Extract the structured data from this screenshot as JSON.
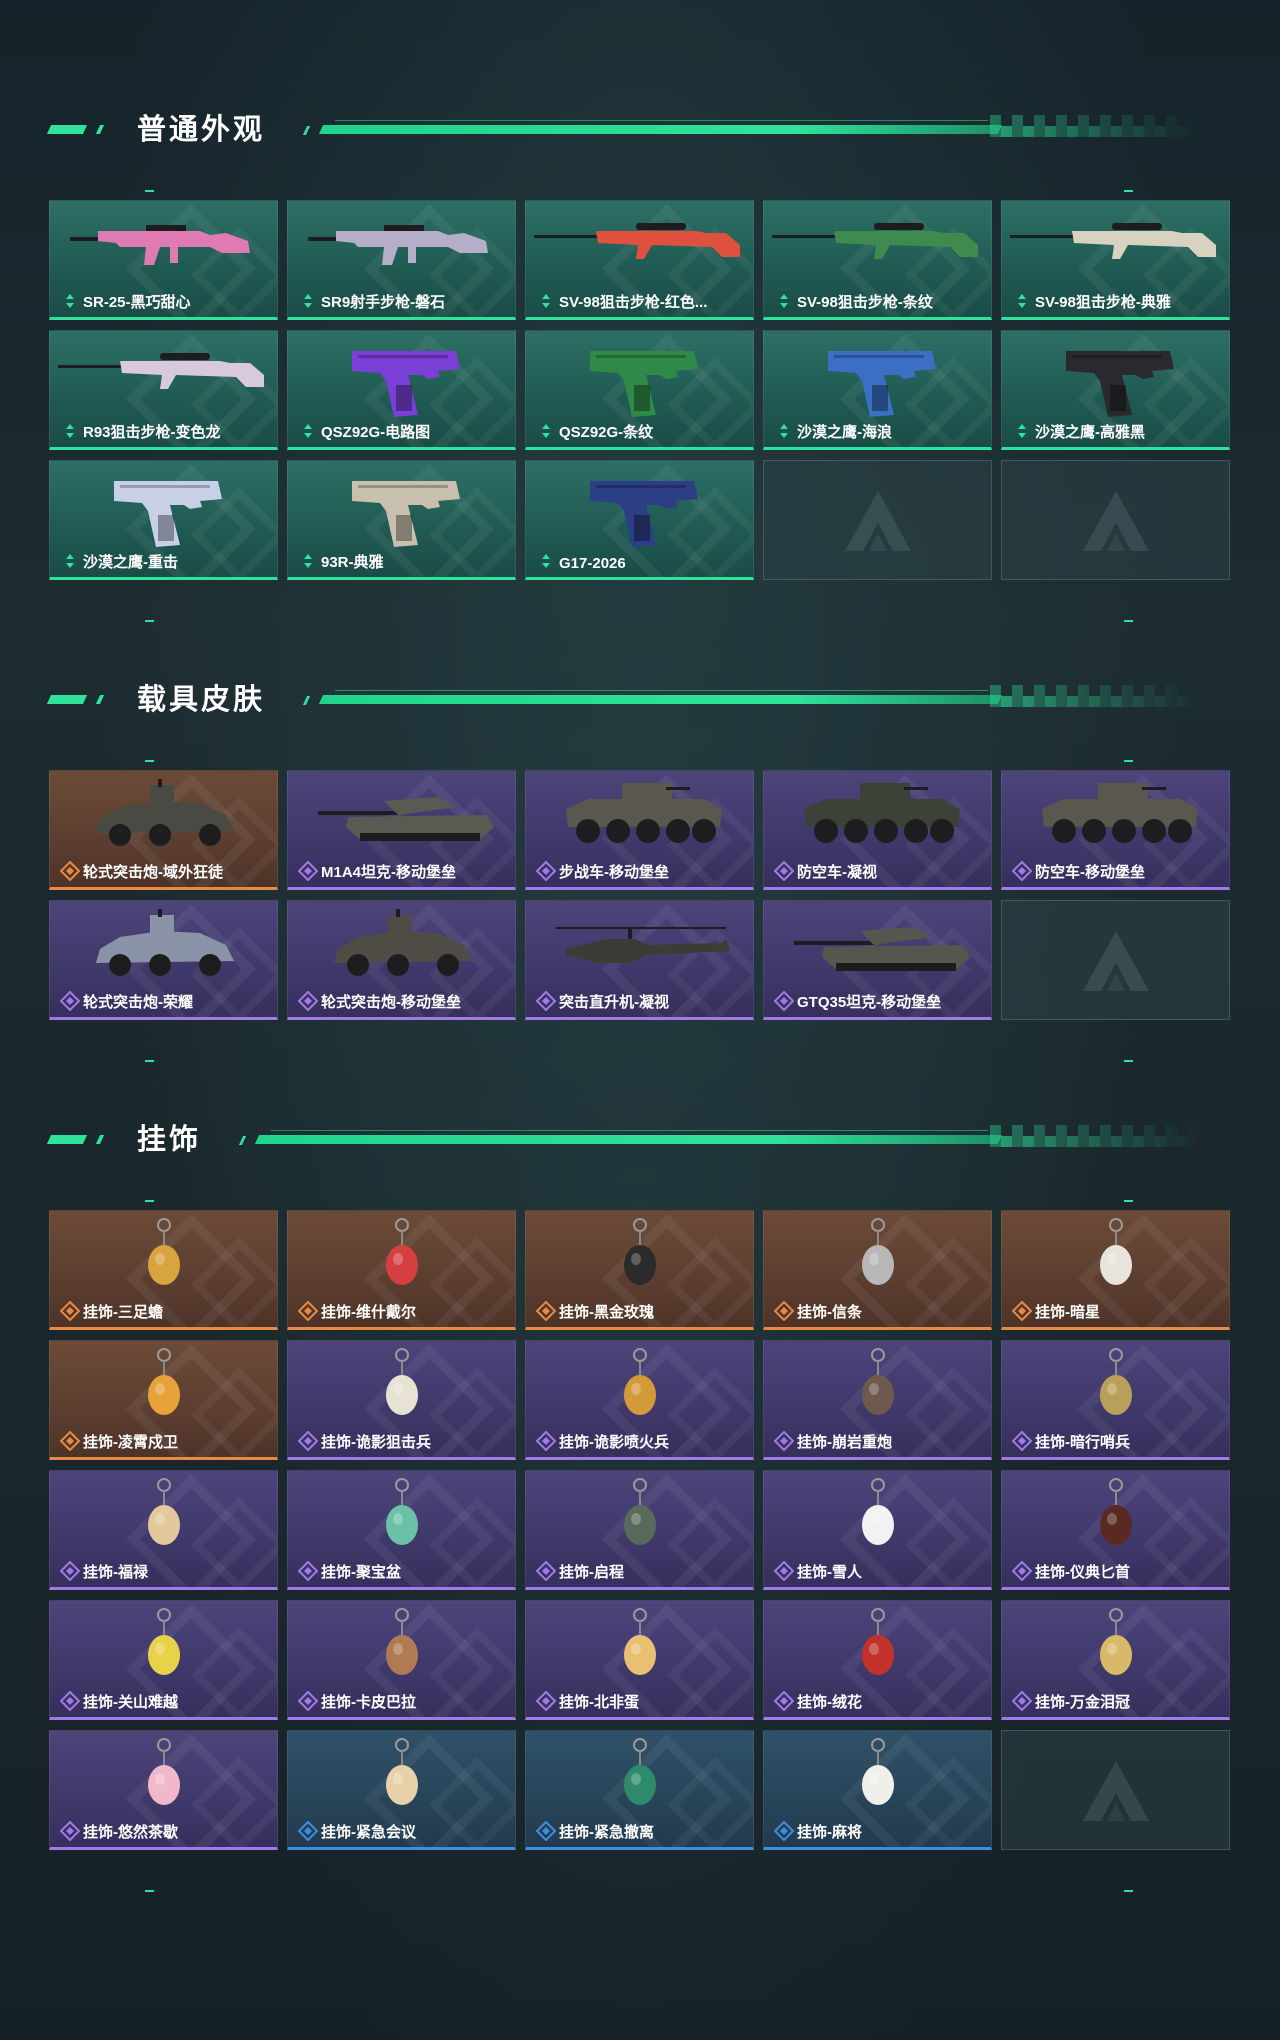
{
  "colors": {
    "accent": "#2fe39b",
    "tier_green": "#2fe39b",
    "tier_orange": "#e98a43",
    "tier_purple": "#a07ae6",
    "tier_blue": "#3f8de0",
    "background": "#1a262c"
  },
  "sections": [
    {
      "title": "普通外观",
      "items": [
        {
          "label": "SR-25-黑巧甜心",
          "tier": "green",
          "art": "rifle",
          "color": "#e07ab3"
        },
        {
          "label": "SR9射手步枪-磐石",
          "tier": "green",
          "art": "rifle",
          "color": "#b6aec9"
        },
        {
          "label": "SV-98狙击步枪-红色...",
          "tier": "green",
          "art": "sniper",
          "color": "#e0503f"
        },
        {
          "label": "SV-98狙击步枪-条纹",
          "tier": "green",
          "art": "sniper",
          "color": "#3f8a4e"
        },
        {
          "label": "SV-98狙击步枪-典雅",
          "tier": "green",
          "art": "sniper",
          "color": "#d8d2c0"
        },
        {
          "label": "R93狙击步枪-变色龙",
          "tier": "green",
          "art": "sniper",
          "color": "#d9c9dd"
        },
        {
          "label": "QSZ92G-电路图",
          "tier": "green",
          "art": "pistol",
          "color": "#7a3fd6"
        },
        {
          "label": "QSZ92G-条纹",
          "tier": "green",
          "art": "pistol",
          "color": "#2f8a48"
        },
        {
          "label": "沙漠之鹰-海浪",
          "tier": "green",
          "art": "pistol",
          "color": "#3a6fc4"
        },
        {
          "label": "沙漠之鹰-高雅黑",
          "tier": "green",
          "art": "pistol",
          "color": "#2a2a2e"
        },
        {
          "label": "沙漠之鹰-重击",
          "tier": "green",
          "art": "pistol",
          "color": "#c8d0e8"
        },
        {
          "label": "93R-典雅",
          "tier": "green",
          "art": "pistol",
          "color": "#c9bfae"
        },
        {
          "label": "G17-2026",
          "tier": "green",
          "art": "pistol",
          "color": "#2c3f86"
        },
        {
          "label": "",
          "tier": "empty",
          "art": "none",
          "color": ""
        },
        {
          "label": "",
          "tier": "empty",
          "art": "none",
          "color": ""
        }
      ]
    },
    {
      "title": "载具皮肤",
      "items": [
        {
          "label": "轮式突击炮-域外狂徒",
          "tier": "orange",
          "art": "vehicle",
          "color": "#4a4a44"
        },
        {
          "label": "M1A4坦克-移动堡垒",
          "tier": "purple",
          "art": "tank",
          "color": "#5b5a52"
        },
        {
          "label": "步战车-移动堡垒",
          "tier": "purple",
          "art": "apc",
          "color": "#5a574f"
        },
        {
          "label": "防空车-凝视",
          "tier": "purple",
          "art": "apc",
          "color": "#3d4238"
        },
        {
          "label": "防空车-移动堡垒",
          "tier": "purple",
          "art": "apc",
          "color": "#5a574f"
        },
        {
          "label": "轮式突击炮-荣耀",
          "tier": "purple",
          "art": "vehicle",
          "color": "#8a93a8"
        },
        {
          "label": "轮式突击炮-移动堡垒",
          "tier": "purple",
          "art": "vehicle",
          "color": "#4f4c45"
        },
        {
          "label": "突击直升机-凝视",
          "tier": "purple",
          "art": "heli",
          "color": "#3a3d35"
        },
        {
          "label": "GTQ35坦克-移动堡垒",
          "tier": "purple",
          "art": "tank",
          "color": "#57564e"
        },
        {
          "label": "",
          "tier": "empty",
          "art": "none",
          "color": ""
        }
      ]
    },
    {
      "title": "挂饰",
      "items": [
        {
          "label": "挂饰-三足蟾",
          "tier": "orange",
          "art": "charm",
          "color": "#d8a440"
        },
        {
          "label": "挂饰-维什戴尔",
          "tier": "orange",
          "art": "charm",
          "color": "#d63f3f"
        },
        {
          "label": "挂饰-黑金玫瑰",
          "tier": "orange",
          "art": "charm",
          "color": "#2b2b2b"
        },
        {
          "label": "挂饰-信条",
          "tier": "orange",
          "art": "charm",
          "color": "#b8b8b8"
        },
        {
          "label": "挂饰-暗星",
          "tier": "orange",
          "art": "charm",
          "color": "#e8e4dc"
        },
        {
          "label": "挂饰-凌霄戍卫",
          "tier": "orange",
          "art": "charm",
          "color": "#e8a23a"
        },
        {
          "label": "挂饰-诡影狙击兵",
          "tier": "purple",
          "art": "charm",
          "color": "#e8e2d4"
        },
        {
          "label": "挂饰-诡影喷火兵",
          "tier": "purple",
          "art": "charm",
          "color": "#d49a3a"
        },
        {
          "label": "挂饰-崩岩重炮",
          "tier": "purple",
          "art": "charm",
          "color": "#6d5a4c"
        },
        {
          "label": "挂饰-暗行哨兵",
          "tier": "purple",
          "art": "charm",
          "color": "#b8a05a"
        },
        {
          "label": "挂饰-福禄",
          "tier": "purple",
          "art": "charm",
          "color": "#e2c89a"
        },
        {
          "label": "挂饰-聚宝盆",
          "tier": "purple",
          "art": "charm",
          "color": "#6bc0a8"
        },
        {
          "label": "挂饰-启程",
          "tier": "purple",
          "art": "charm",
          "color": "#5a6a5a"
        },
        {
          "label": "挂饰-雪人",
          "tier": "purple",
          "art": "charm",
          "color": "#f2f2f2"
        },
        {
          "label": "挂饰-仪典匕首",
          "tier": "purple",
          "art": "charm",
          "color": "#5a2a22"
        },
        {
          "label": "挂饰-关山难越",
          "tier": "purple",
          "art": "charm",
          "color": "#e8d24a"
        },
        {
          "label": "挂饰-卡皮巴拉",
          "tier": "purple",
          "art": "charm",
          "color": "#b07a52"
        },
        {
          "label": "挂饰-北非蛋",
          "tier": "purple",
          "art": "charm",
          "color": "#e8c070"
        },
        {
          "label": "挂饰-绒花",
          "tier": "purple",
          "art": "charm",
          "color": "#c2322a"
        },
        {
          "label": "挂饰-万金泪冠",
          "tier": "purple",
          "art": "charm",
          "color": "#d9b86a"
        },
        {
          "label": "挂饰-悠然茶歇",
          "tier": "purple",
          "art": "charm",
          "color": "#f0b8c8"
        },
        {
          "label": "挂饰-紧急会议",
          "tier": "blue",
          "art": "charm",
          "color": "#e8d0a8"
        },
        {
          "label": "挂饰-紧急撤离",
          "tier": "blue",
          "art": "charm",
          "color": "#2e8a6a"
        },
        {
          "label": "挂饰-麻将",
          "tier": "blue",
          "art": "charm",
          "color": "#f0f0ea"
        },
        {
          "label": "",
          "tier": "empty",
          "art": "none",
          "color": ""
        }
      ]
    }
  ]
}
